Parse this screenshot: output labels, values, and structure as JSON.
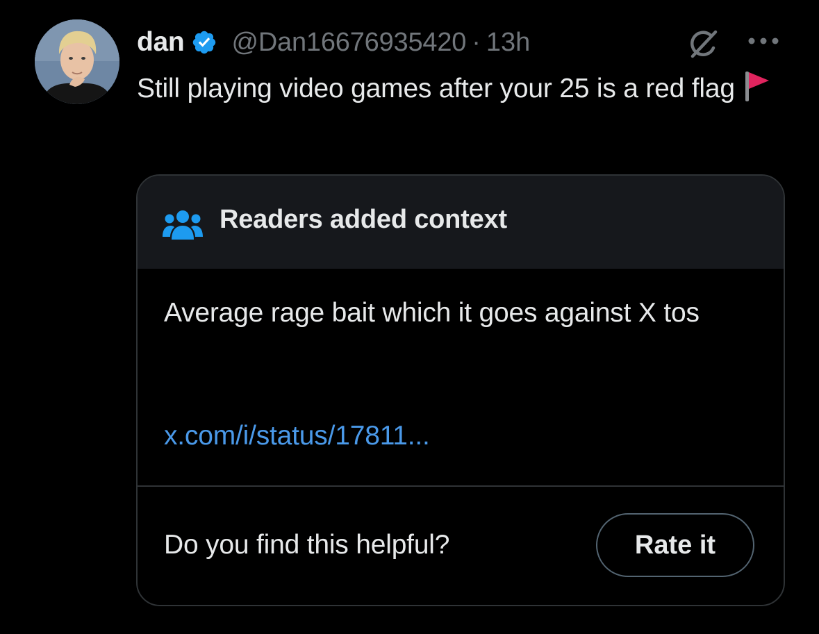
{
  "tweet": {
    "display_name": "dan",
    "handle": "@Dan16676935420",
    "separator": "·",
    "time": "13h",
    "text": "Still playing video games after your 25 is a red flag",
    "emoji": "triangular-flag",
    "verified": true,
    "icons": {
      "verified": "verified-badge-icon",
      "grok": "grok-icon",
      "more": "more-icon"
    }
  },
  "community_note": {
    "title": "Readers added context",
    "icon": "readers-icon",
    "body": "Average rage bait which it goes against X tos",
    "link": "x.com/i/status/17811...",
    "prompt": "Do you find this helpful?",
    "rate_button": "Rate it"
  },
  "colors": {
    "background": "#000000",
    "text_primary": "#e7e9ea",
    "text_secondary": "#71767b",
    "accent_blue": "#1d9bf0",
    "link_blue": "#4a99e9",
    "note_header_bg": "#16181c",
    "border": "#2f3336",
    "flag_red": "#e0245e"
  }
}
